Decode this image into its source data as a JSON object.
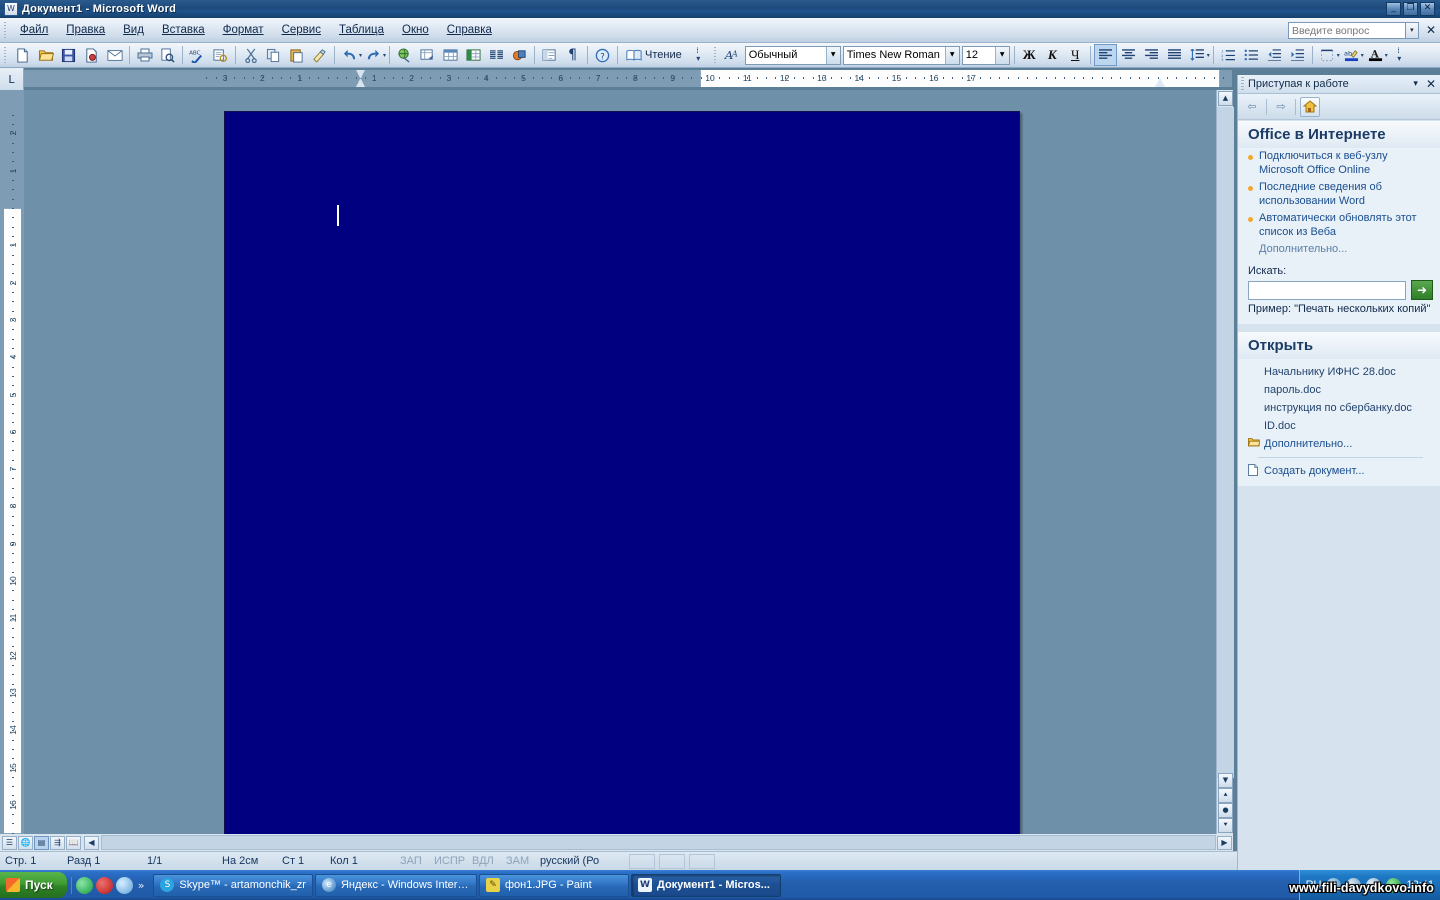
{
  "window": {
    "title": "Документ1 - Microsoft Word",
    "app_icon": "word-icon",
    "buttons": {
      "minimize": "_",
      "maximize": "❐",
      "close": "✕"
    },
    "doc_buttons": {
      "minimize": "_",
      "restore": "❐",
      "close": "✕"
    }
  },
  "menu": {
    "items": [
      {
        "label": "Файл",
        "name": "menu-file"
      },
      {
        "label": "Правка",
        "name": "menu-edit"
      },
      {
        "label": "Вид",
        "name": "menu-view"
      },
      {
        "label": "Вставка",
        "name": "menu-insert"
      },
      {
        "label": "Формат",
        "name": "menu-format"
      },
      {
        "label": "Сервис",
        "name": "menu-tools"
      },
      {
        "label": "Таблица",
        "name": "menu-table"
      },
      {
        "label": "Окно",
        "name": "menu-window"
      },
      {
        "label": "Справка",
        "name": "menu-help"
      }
    ],
    "ask_placeholder": "Введите вопрос",
    "ask_value": "",
    "close_glyph": "✕"
  },
  "toolbar": {
    "buttons": [
      {
        "name": "new-document-icon",
        "glyph": "🗋",
        "tip": "Создать"
      },
      {
        "name": "open-folder-icon",
        "glyph": "📂",
        "tip": "Открыть"
      },
      {
        "name": "save-icon",
        "glyph": "💾",
        "tip": "Сохранить"
      },
      {
        "name": "permission-icon",
        "glyph": "🗎",
        "tip": "Разрешение"
      },
      {
        "name": "email-icon",
        "glyph": "✉",
        "tip": "Сообщение"
      },
      {
        "name": "print-icon",
        "glyph": "🖨",
        "tip": "Печать"
      },
      {
        "name": "print-preview-icon",
        "glyph": "🔍",
        "tip": "Предварительный просмотр"
      },
      {
        "name": "spellcheck-icon",
        "glyph": "ABC",
        "tip": "Правописание"
      },
      {
        "name": "research-icon",
        "glyph": "🔎",
        "tip": "Справочные материалы"
      },
      {
        "name": "cut-icon",
        "glyph": "✂",
        "tip": "Вырезать"
      },
      {
        "name": "copy-icon",
        "glyph": "⧉",
        "tip": "Копировать"
      },
      {
        "name": "paste-icon",
        "glyph": "📋",
        "tip": "Вставить"
      },
      {
        "name": "format-painter-icon",
        "glyph": "🖌",
        "tip": "Формат по образцу"
      },
      {
        "name": "undo-icon",
        "glyph": "↶",
        "tip": "Отменить"
      },
      {
        "name": "redo-icon",
        "glyph": "↷",
        "tip": "Вернуть"
      },
      {
        "name": "hyperlink-icon",
        "glyph": "🌐",
        "tip": "Гиперссылка"
      },
      {
        "name": "tables-borders-icon",
        "glyph": "▤",
        "tip": "Таблицы и границы"
      },
      {
        "name": "insert-table-icon",
        "glyph": "⊞",
        "tip": "Добавить таблицу"
      },
      {
        "name": "insert-excel-icon",
        "glyph": "▦",
        "tip": "Добавить таблицу Excel"
      },
      {
        "name": "columns-icon",
        "glyph": "▥",
        "tip": "Колонки"
      },
      {
        "name": "drawing-icon",
        "glyph": "◨",
        "tip": "Рисование"
      },
      {
        "name": "document-map-icon",
        "glyph": "🗺",
        "tip": "Схема документа"
      },
      {
        "name": "show-formatting-icon",
        "glyph": "¶",
        "tip": "Непечатаемые знаки"
      },
      {
        "name": "help-icon",
        "glyph": "?",
        "tip": "Справка"
      }
    ],
    "read_label": "Чтение",
    "read_icon": "book-icon",
    "style_value": "Обычный",
    "font_value": "Times New Roman",
    "size_value": "12",
    "bold_label": "Ж",
    "italic_label": "К",
    "underline_label": "Ч",
    "align_icons": [
      "align-left-icon",
      "align-center-icon",
      "align-right-icon",
      "align-justify-icon"
    ],
    "line_spacing_icon": "line-spacing-icon",
    "numbering_icon": "numbered-list-icon",
    "bullets_icon": "bulleted-list-icon",
    "decrease_indent_icon": "decrease-indent-icon",
    "increase_indent_icon": "increase-indent-icon",
    "borders_icon": "borders-icon",
    "highlight_icon": "highlight-icon",
    "font_color_icon": "font-color-icon",
    "font_color": "#000000",
    "highlight_color": "#1a3fc0"
  },
  "ruler": {
    "corner_tab": "L",
    "horizontal_ticks": [
      "3",
      "2",
      "1",
      "1",
      "2",
      "3",
      "4",
      "5",
      "6",
      "7",
      "8",
      "9",
      "10",
      "11",
      "12",
      "13",
      "14",
      "15",
      "16",
      "17"
    ],
    "vertical_ticks": [
      "2",
      "1",
      "1",
      "2",
      "3",
      "4",
      "5",
      "6",
      "7",
      "8",
      "9",
      "10",
      "11",
      "12",
      "13",
      "14",
      "15",
      "16"
    ],
    "left_indent_cm": "0",
    "right_indent_cm": "17"
  },
  "document": {
    "page_background": "#000080",
    "caret_visible": true,
    "content": ""
  },
  "scrollbars": {
    "up_glyph": "▲",
    "down_glyph": "▼",
    "prev_page_glyph": "⯅",
    "browse_object_glyph": "●",
    "next_page_glyph": "⯆",
    "left_glyph": "◀",
    "right_glyph": "▶"
  },
  "view_buttons": [
    {
      "name": "view-normal",
      "glyph": "☰"
    },
    {
      "name": "view-web-layout",
      "glyph": "🌐"
    },
    {
      "name": "view-print-layout",
      "glyph": "▤",
      "active": true
    },
    {
      "name": "view-outline",
      "glyph": "⇶"
    },
    {
      "name": "view-reading",
      "glyph": "📖"
    }
  ],
  "statusbar": {
    "cells": [
      {
        "name": "status-page",
        "text": "Стр.  1",
        "dim": false
      },
      {
        "name": "status-section",
        "text": "Разд  1",
        "dim": false
      },
      {
        "name": "status-pages",
        "text": "1/1",
        "dim": false
      },
      {
        "name": "status-at",
        "text": "На  2см",
        "dim": false
      },
      {
        "name": "status-line",
        "text": "Ст  1",
        "dim": false
      },
      {
        "name": "status-col",
        "text": "Кол  1",
        "dim": false
      },
      {
        "name": "status-rec",
        "text": "ЗАП",
        "dim": true
      },
      {
        "name": "status-trk",
        "text": "ИСПР",
        "dim": true
      },
      {
        "name": "status-ext",
        "text": "ВДЛ",
        "dim": true
      },
      {
        "name": "status-ovr",
        "text": "ЗАМ",
        "dim": true
      },
      {
        "name": "status-language",
        "text": "русский (Ро",
        "dim": false
      }
    ]
  },
  "taskpane": {
    "title": "Приступая к работе",
    "dropdown_glyph": "▾",
    "close_glyph": "✕",
    "nav": {
      "back_glyph": "⇦",
      "forward_glyph": "⇨",
      "home_glyph": "⌂"
    },
    "sections": [
      {
        "name": "office-online",
        "heading": "Office в Интернете",
        "links": [
          "Подключиться к веб-узлу Microsoft Office Online",
          "Последние сведения об использовании Word",
          "Автоматически обновлять этот список из Веба"
        ],
        "more": "Дополнительно..."
      }
    ],
    "search": {
      "label": "Искать:",
      "value": "",
      "go_glyph": "➜",
      "example": "Пример:  \"Печать нескольких копий\""
    },
    "open": {
      "heading": "Открыть",
      "documents": [
        "Начальнику ИФНС 28.doc",
        "пароль.doc",
        "инструкция по сбербанку.doc",
        "ID.doc"
      ],
      "more": "Дополнительно...",
      "more_icon": "folder-icon",
      "create": "Создать документ...",
      "create_icon": "page-icon"
    }
  },
  "taskbar": {
    "start_label": "Пуск",
    "quick_launch": [
      {
        "name": "ql-phone-icon",
        "color": "#1f8f3a",
        "glyph": "☏"
      },
      {
        "name": "ql-opera-icon",
        "color": "#c81f1f",
        "glyph": "O"
      },
      {
        "name": "ql-browser-icon",
        "color": "#7fb8e8",
        "glyph": "e"
      }
    ],
    "overflow_glyph": "»",
    "items": [
      {
        "name": "taskbar-item-skype",
        "label": "Skype™ - artamonchik_zr",
        "icon_color": "#2aa5e0",
        "icon_glyph": "S",
        "active": false
      },
      {
        "name": "taskbar-item-yandex",
        "label": "Яндекс - Windows Intern...",
        "icon_color": "#3f8fd0",
        "icon_glyph": "e",
        "active": false
      },
      {
        "name": "taskbar-item-paint",
        "label": "фон1.JPG - Paint",
        "icon_color": "#e8d24a",
        "icon_glyph": "🖌",
        "active": false
      },
      {
        "name": "taskbar-item-word",
        "label": "Документ1 - Micros...",
        "icon_color": "#e8f0fa",
        "icon_glyph": "W",
        "active": true
      }
    ],
    "tray": {
      "lang": "RU",
      "icons": [
        {
          "name": "tray-shield-icon",
          "color": "#5b9bd5"
        },
        {
          "name": "tray-network-icon",
          "color": "#8fbcdb"
        },
        {
          "name": "tray-volume-icon",
          "color": "#a8c8e0"
        },
        {
          "name": "tray-antivirus-icon",
          "color": "#2f9e3f"
        }
      ],
      "clock": "12:41"
    }
  },
  "watermark": "www.fili-davydkovo.info"
}
